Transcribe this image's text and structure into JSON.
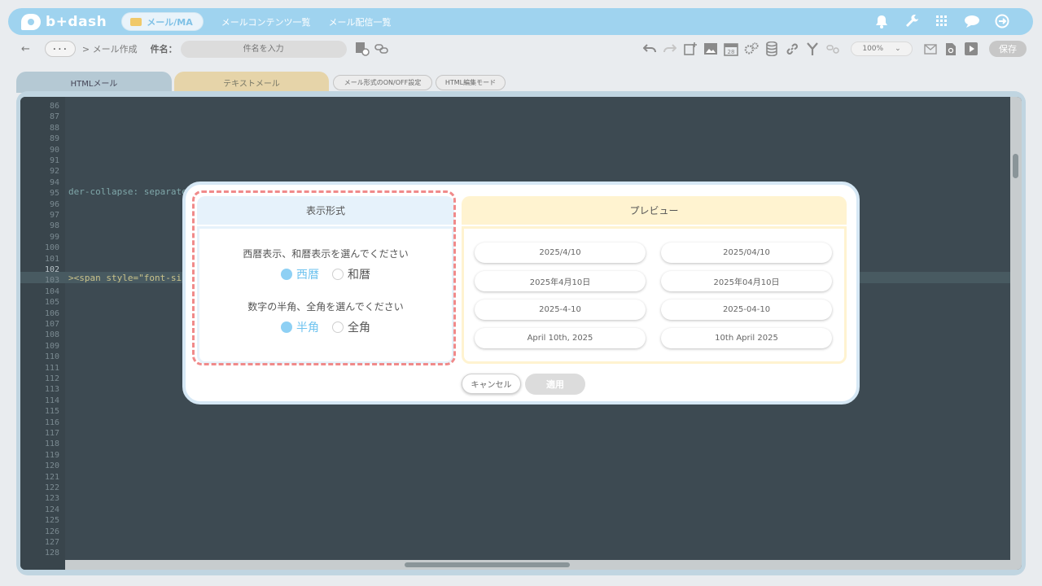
{
  "app": {
    "logo_text": "b+dash"
  },
  "nav": {
    "active_tab": "メール/MA",
    "links": [
      "メールコンテンツ一覧",
      "メール配信一覧"
    ],
    "icons": [
      "bell-icon",
      "wrench-icon",
      "grid-icon",
      "chat-icon",
      "logout-icon"
    ]
  },
  "toolbar": {
    "back": "←",
    "more": "･･･",
    "breadcrumb": "> メール作成",
    "subject_label": "件名：",
    "subject_placeholder": "件名を入力",
    "zoom_value": "100%",
    "save_label": "保存"
  },
  "editor_tabs": {
    "html": "HTMLメール",
    "text": "テキストメール",
    "onoff": "メール形式のON/OFF設定",
    "edit_mode": "HTML編集モード"
  },
  "editor": {
    "line_numbers": [
      "86",
      "87",
      "88",
      "89",
      "90",
      "91",
      "92",
      "94",
      "95",
      "96",
      "97",
      "98",
      "99",
      "100",
      "101",
      "102",
      "103",
      "104",
      "105",
      "106",
      "107",
      "108",
      "109",
      "110",
      "111",
      "112",
      "113",
      "114",
      "115",
      "116",
      "117",
      "118",
      "119",
      "120",
      "121",
      "122",
      "123",
      "124",
      "125",
      "126",
      "127",
      "128"
    ],
    "line_94_text": "der-collapse: separate",
    "line_102_text": "><span style=\"font-si"
  },
  "dialog": {
    "left_title": "表示形式",
    "era_question": "西暦表示、和暦表示を選んでください",
    "era_options": [
      "西暦",
      "和暦"
    ],
    "era_selected": "西暦",
    "width_question": "数字の半角、全角を選んでください",
    "width_options": [
      "半角",
      "全角"
    ],
    "width_selected": "半角",
    "preview_title": "プレビュー",
    "preview_formats": [
      "2025/4/10",
      "2025/04/10",
      "2025年4月10日",
      "2025年04月10日",
      "2025-4-10",
      "2025-04-10",
      "April 10th, 2025",
      "10th April 2025"
    ],
    "cancel_label": "キャンセル",
    "apply_label": "適用"
  },
  "colors": {
    "nav_bg": "#9fd3ef",
    "accent": "#6fc3ef",
    "highlight_dash": "#f08a8a",
    "editor_bg": "#3d4a52"
  }
}
